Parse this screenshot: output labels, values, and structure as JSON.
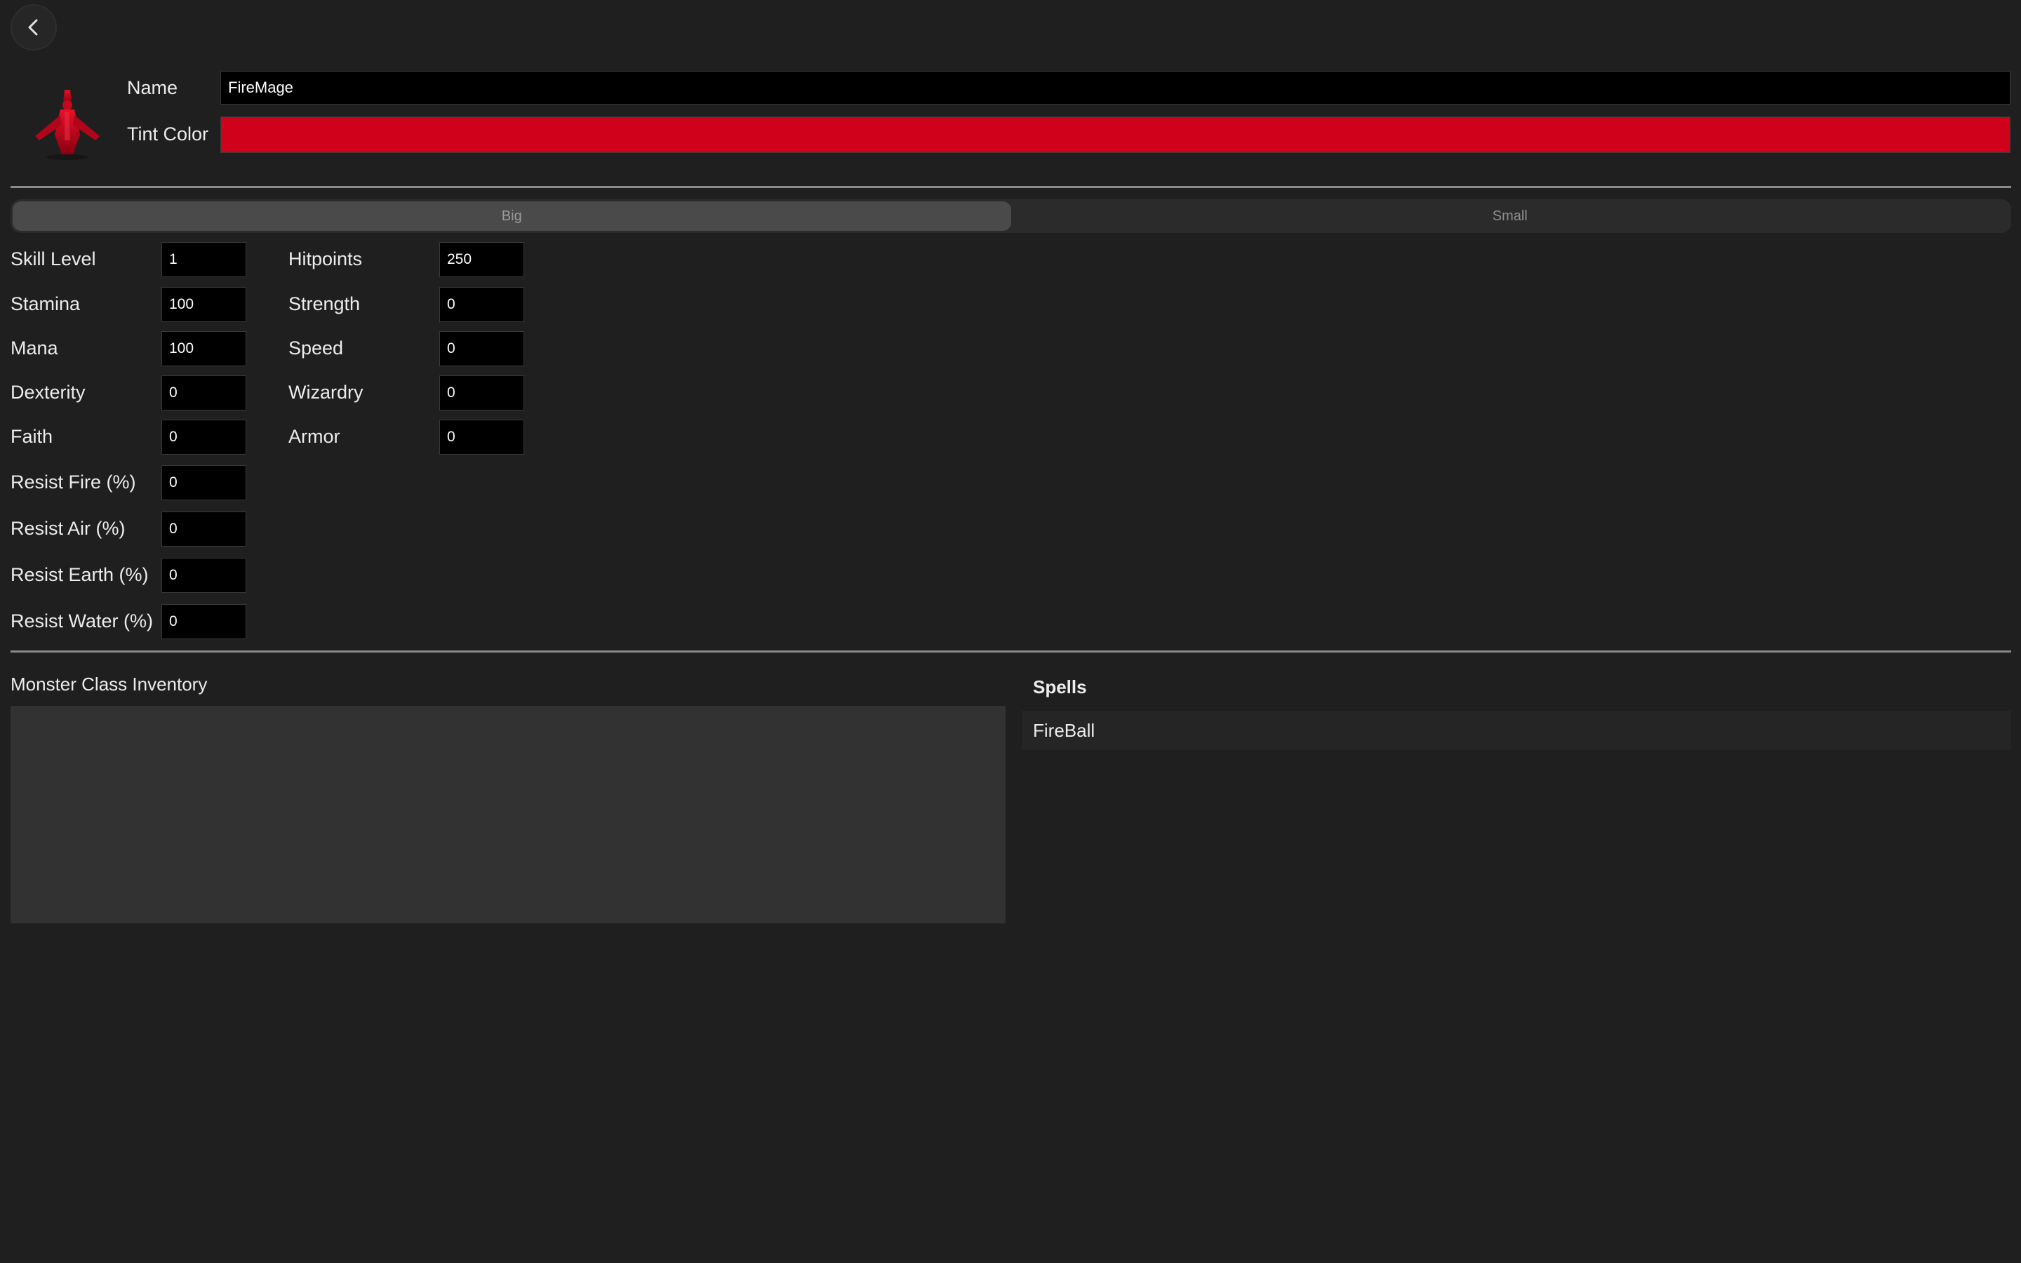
{
  "header": {
    "back_icon": "chevron-left-icon"
  },
  "monster": {
    "icon": "red-monster-sprite-icon",
    "name_label": "Name",
    "name_value": "FireMage",
    "tint_label": "Tint Color",
    "tint_color": "#d0021b"
  },
  "size_toggle": {
    "options": [
      "Big",
      "Small"
    ],
    "selected": "Big"
  },
  "stats_left": [
    {
      "label": "Skill Level",
      "value": "1"
    },
    {
      "label": "Stamina",
      "value": "100"
    },
    {
      "label": "Mana",
      "value": "100"
    },
    {
      "label": "Dexterity",
      "value": "0"
    },
    {
      "label": "Faith",
      "value": "0"
    },
    {
      "label": "Resist Fire (%)",
      "value": "0"
    },
    {
      "label": "Resist Air (%)",
      "value": "0"
    },
    {
      "label": "Resist Earth (%)",
      "value": "0"
    },
    {
      "label": "Resist Water (%)",
      "value": "0"
    }
  ],
  "stats_right": [
    {
      "label": "Hitpoints",
      "value": "250"
    },
    {
      "label": "Strength",
      "value": "0"
    },
    {
      "label": "Speed",
      "value": "0"
    },
    {
      "label": "Wizardry",
      "value": "0"
    },
    {
      "label": "Armor",
      "value": "0"
    }
  ],
  "inventory": {
    "title": "Monster Class Inventory"
  },
  "spells": {
    "title": "Spells",
    "items": [
      "FireBall"
    ]
  }
}
